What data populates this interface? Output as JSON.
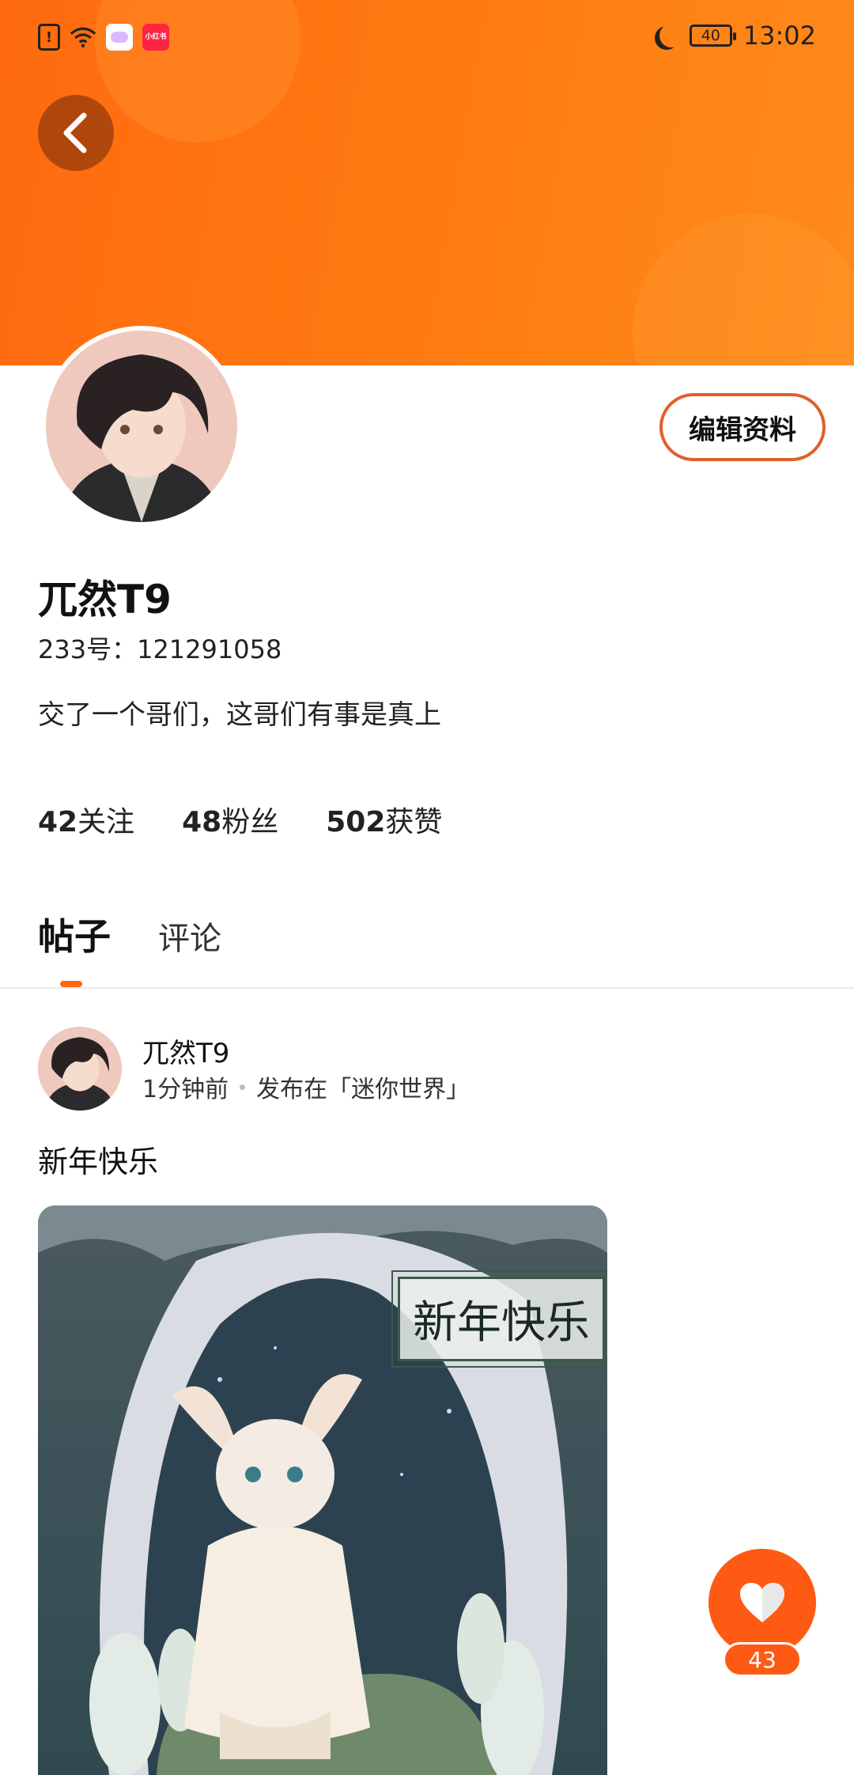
{
  "status_bar": {
    "app2_label": "小红书",
    "battery": "40",
    "time": "13:02"
  },
  "profile": {
    "edit_label": "编辑资料",
    "name": "兀然T9",
    "id_text": "233号：121291058",
    "bio": "交了一个哥们，这哥们有事是真上",
    "stats": [
      {
        "count": "42",
        "label": "关注"
      },
      {
        "count": "48",
        "label": "粉丝"
      },
      {
        "count": "502",
        "label": "获赞"
      }
    ]
  },
  "tabs": [
    {
      "label": "帖子",
      "active": true
    },
    {
      "label": "评论",
      "active": false
    }
  ],
  "post": {
    "author": "兀然T9",
    "time": "1分钟前",
    "location": "发布在「迷你世界」",
    "text": "新年快乐",
    "image_caption": "新年快乐",
    "likes": "43"
  },
  "colors": {
    "accent": "#ff6a10",
    "like_button": "#ff5a14"
  }
}
